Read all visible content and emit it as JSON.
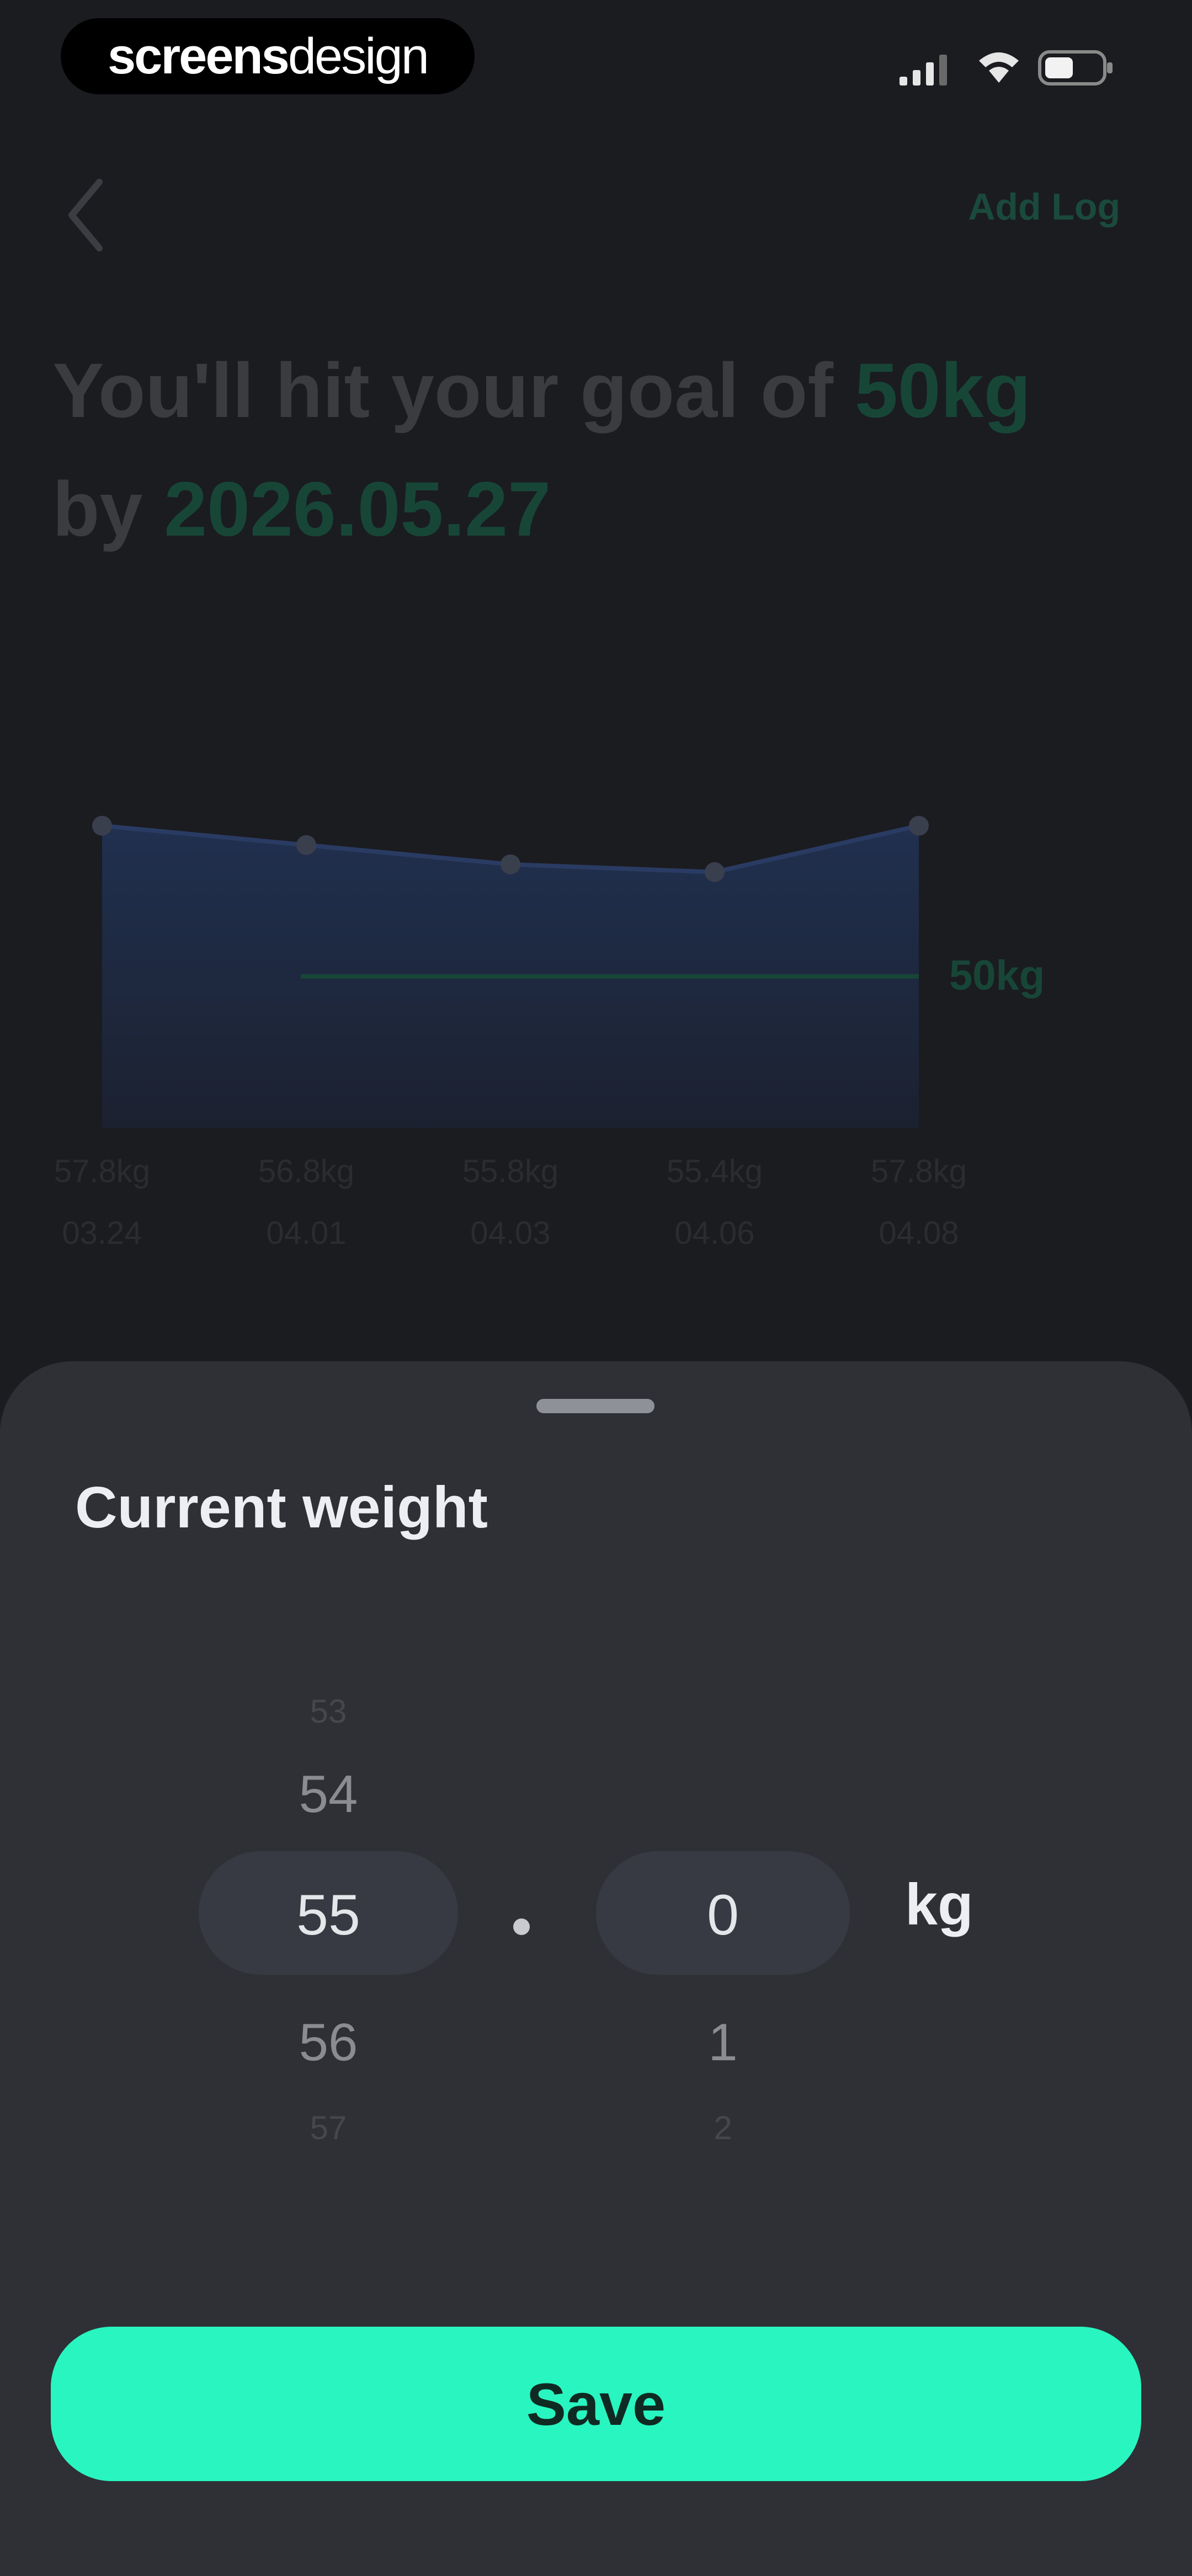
{
  "status_bar": {
    "brand_part1": "screens",
    "brand_part2": "design",
    "icons": [
      "signal-icon",
      "wifi-icon",
      "battery-icon"
    ]
  },
  "header": {
    "back_icon": "chevron-left-icon",
    "add_log_label": "Add Log"
  },
  "headline": {
    "prefix": "You'll hit your goal of ",
    "goal_value": "50kg",
    "by_text": "by ",
    "goal_date": "2026.05.27"
  },
  "chart_data": {
    "type": "area",
    "x_dates": [
      "03.24",
      "04.01",
      "04.03",
      "04.06",
      "04.08"
    ],
    "weight_labels": [
      "57.8kg",
      "56.8kg",
      "55.8kg",
      "55.4kg",
      "57.8kg"
    ],
    "series": [
      {
        "values": [
          57.8,
          56.8,
          55.8,
          55.4,
          57.8
        ]
      }
    ],
    "goal_line": {
      "value": 50,
      "label": "50kg"
    },
    "ylim": [
      44,
      60
    ],
    "grid": false,
    "colors": {
      "area": "#1e2a44",
      "line": "#2a3b63",
      "goal": "#174637"
    }
  },
  "sheet": {
    "title": "Current weight",
    "integer_picker": {
      "above2": "53",
      "above1": "54",
      "selected": "55",
      "below1": "56",
      "below2": "57"
    },
    "separator": ".",
    "decimal_picker": {
      "selected": "0",
      "below1": "1",
      "below2": "2"
    },
    "unit": "kg",
    "save_label": "Save"
  },
  "colors": {
    "accent": "#29f5c0",
    "accent_dim": "#174637",
    "sheet_bg": "#2e3036",
    "page_bg": "#1b1c20"
  }
}
